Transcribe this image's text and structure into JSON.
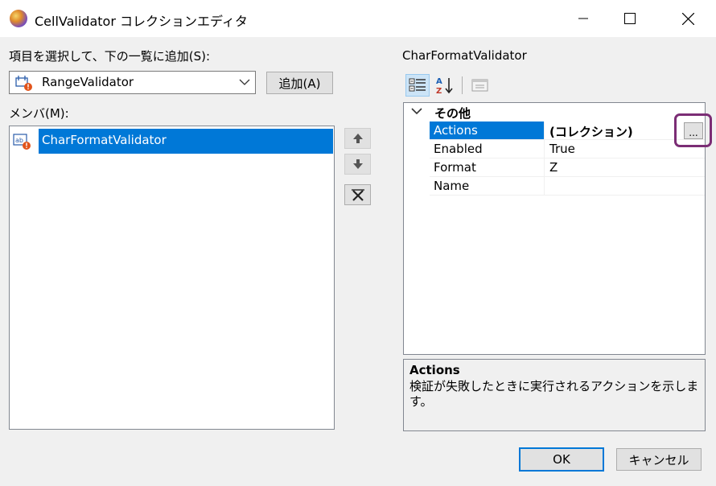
{
  "window": {
    "title": "CellValidator コレクションエディタ",
    "icon": "app-icon",
    "controls": [
      "minimize-icon",
      "maximize-icon",
      "close-icon"
    ]
  },
  "left": {
    "add_label": "項目を選択して、下の一覧に追加(S):",
    "type_combo": {
      "value": "RangeValidator",
      "icon": "range-validator-icon"
    },
    "add_button": "追加(A)",
    "members_label": "メンバ(M):",
    "members": [
      {
        "label": "CharFormatValidator",
        "icon": "char-format-validator-icon",
        "selected": true
      }
    ],
    "move_buttons": [
      "move-up-icon",
      "move-down-icon",
      "remove-icon"
    ]
  },
  "right": {
    "selected_name": "CharFormatValidator",
    "toolbar": [
      "categorized-icon",
      "alphabetical-icon",
      "property-pages-icon"
    ],
    "category": "その他",
    "properties": [
      {
        "name": "Actions",
        "value": "(コレクション)",
        "selected": true,
        "bold": true,
        "has_ellipsis": true
      },
      {
        "name": "Enabled",
        "value": "True"
      },
      {
        "name": "Format",
        "value": "Z"
      },
      {
        "name": "Name",
        "value": ""
      }
    ],
    "ellipsis_label": "...",
    "description": {
      "title": "Actions",
      "text": "検証が失敗したときに実行されるアクションを示します。"
    },
    "highlight_color": "#7b2d75"
  },
  "footer": {
    "ok": "OK",
    "cancel": "キャンセル"
  },
  "colors": {
    "accent": "#0078d7",
    "window_bg": "#f0f0f0"
  }
}
